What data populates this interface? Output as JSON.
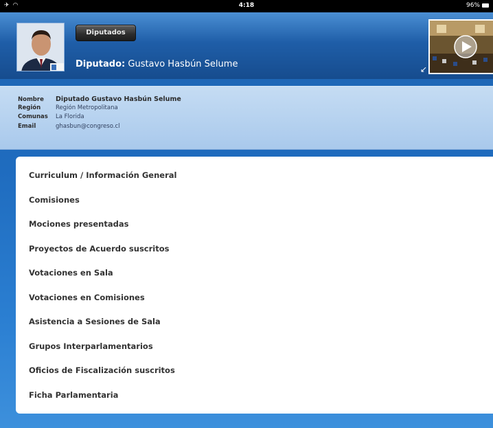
{
  "status_bar": {
    "time": "4:18",
    "battery": "96%",
    "airplane_icon": "airplane-icon",
    "wifi_icon": "wifi-icon",
    "battery_icon": "battery-icon"
  },
  "header": {
    "back_button_label": "Diputados",
    "title_label": "Diputado:",
    "title_value": "Gustavo Hasbún Selume"
  },
  "info": {
    "rows": [
      {
        "key": "Nombre",
        "value": "Diputado Gustavo Hasbún Selume"
      },
      {
        "key": "Región",
        "value": "Región Metropolitana"
      },
      {
        "key": "Comunas",
        "value": "La Florida"
      },
      {
        "key": "Email",
        "value": "ghasbun@congreso.cl"
      }
    ]
  },
  "menu": {
    "items": [
      "Curriculum / Información General",
      "Comisiones",
      "Mociones presentadas",
      "Proyectos de Acuerdo suscritos",
      "Votaciones en Sala",
      "Votaciones en Comisiones",
      "Asistencia a Sesiones de Sala",
      "Grupos Interparlamentarios",
      "Oficios de Fiscalización suscritos",
      "Ficha Parlamentaria"
    ]
  },
  "colors": {
    "header_blue": "#1f5ea8",
    "info_blue": "#b6d1ee",
    "background_blue": "#1f6cbf",
    "menu_text": "#333333"
  }
}
